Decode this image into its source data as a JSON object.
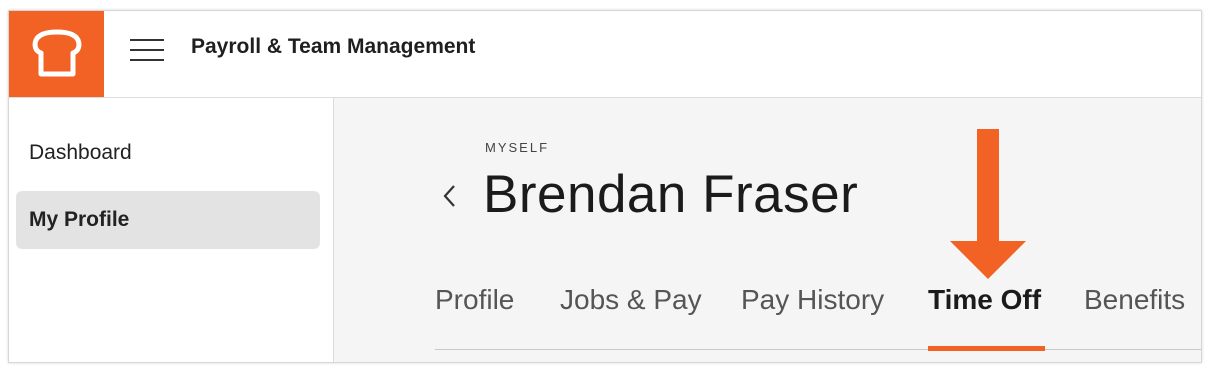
{
  "header": {
    "app_title": "Payroll & Team Management",
    "logo_icon": "toast-bread-icon",
    "menu_icon": "hamburger-menu-icon",
    "brand_color": "#f26225"
  },
  "sidebar": {
    "items": [
      {
        "label": "Dashboard",
        "active": false
      },
      {
        "label": "My Profile",
        "active": true
      }
    ]
  },
  "main": {
    "eyebrow": "MYSELF",
    "person_name": "Brendan Fraser",
    "back_icon": "chevron-left-icon",
    "tabs": [
      {
        "label": "Profile",
        "active": false
      },
      {
        "label": "Jobs & Pay",
        "active": false
      },
      {
        "label": "Pay History",
        "active": false
      },
      {
        "label": "Time Off",
        "active": true
      },
      {
        "label": "Benefits",
        "active": false
      }
    ],
    "annotation_icon": "down-arrow-icon",
    "annotation_color": "#f26225"
  }
}
